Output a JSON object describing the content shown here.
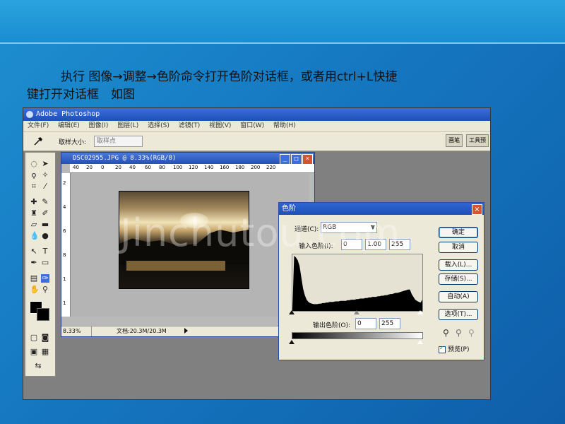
{
  "slide": {
    "caption_line1": "执行 图像→调整→色阶命令打开色阶对话框，或者用ctrl+L快捷",
    "caption_line2": "键打开对话框　如图",
    "watermark": "Jinchutou.com"
  },
  "app": {
    "title": "Adobe Photoshop",
    "menu": [
      "文件(F)",
      "编辑(E)",
      "图像(I)",
      "图层(L)",
      "选择(S)",
      "滤镜(T)",
      "视图(V)",
      "窗口(W)",
      "帮助(H)"
    ],
    "options": {
      "sample_label": "取样大小:",
      "sample_value": "取样点",
      "palette_tabs": [
        "画笔",
        "工具预"
      ]
    }
  },
  "image_window": {
    "title": "DSC02955.JPG @ 8.33%(RGB/8)",
    "ruler_ticks": [
      "40",
      "20",
      "0",
      "20",
      "40",
      "60",
      "80",
      "100",
      "120",
      "140",
      "160",
      "180",
      "200",
      "220"
    ],
    "ruler_v": [
      "2",
      "4",
      "6",
      "8",
      "1",
      "1"
    ],
    "zoom": "8.33%",
    "doc_info": "文档:20.3M/20.3M"
  },
  "levels": {
    "title": "色阶",
    "channel_label": "通道(C):",
    "channel_value": "RGB",
    "input_label": "输入色阶(I):",
    "input_values": [
      "0",
      "1.00",
      "255"
    ],
    "output_label": "输出色阶(O):",
    "output_values": [
      "0",
      "255"
    ],
    "buttons": {
      "ok": "确定",
      "cancel": "取消",
      "load": "载入(L)...",
      "save": "存储(S)...",
      "auto": "自动(A)",
      "options": "选项(T)..."
    },
    "preview_label": "预览(P)",
    "preview_checked": true,
    "histogram": [
      2,
      98,
      95,
      90,
      80,
      60,
      40,
      28,
      20,
      16,
      14,
      13,
      12,
      12,
      12,
      13,
      13,
      14,
      14,
      15,
      15,
      16,
      16,
      16,
      17,
      17,
      17,
      18,
      18,
      18,
      18,
      19,
      19,
      20,
      20,
      20,
      21,
      21,
      22,
      22,
      22,
      23,
      23,
      24,
      24,
      25,
      25,
      25,
      26,
      26,
      27,
      27,
      28,
      28,
      29,
      30,
      30,
      31,
      32,
      32,
      33,
      34,
      35,
      36,
      37,
      38,
      38,
      30,
      25,
      20,
      18,
      16,
      15,
      20
    ]
  }
}
